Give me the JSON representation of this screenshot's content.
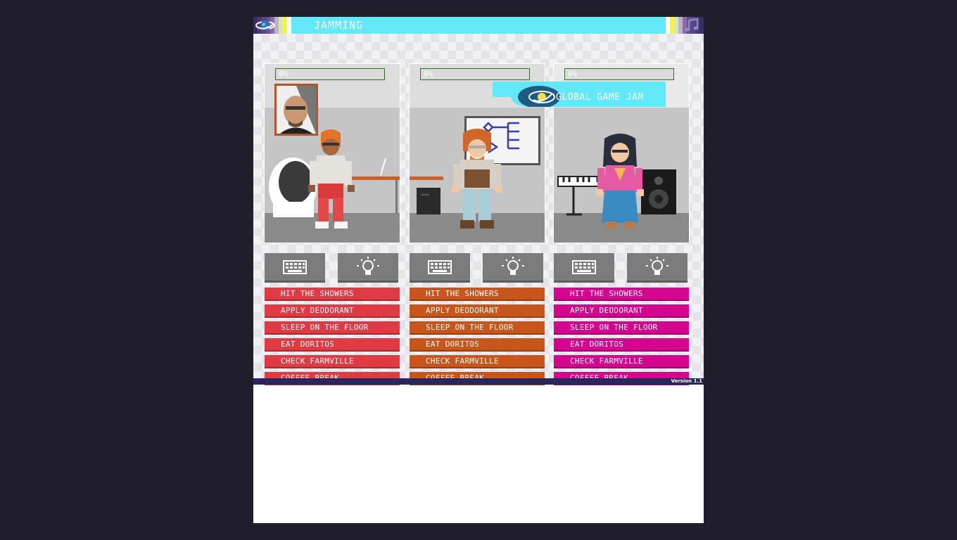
{
  "header": {
    "title": "JAMMING",
    "logo_icon": "globe-planet-icon",
    "music_icon": "music-note-icon",
    "accent": "#62e8f6",
    "stripe_colors": [
      "#3a2f62",
      "#4b3a7a",
      "#6a4b8f",
      "#8a6ba8",
      "#b9b2c8",
      "#e9f1a5",
      "#f4f04c"
    ]
  },
  "footer": {
    "version": "Version 1.1"
  },
  "banner": {
    "text": "GLOBAL GAME JAM",
    "icon": "globe-planet-icon"
  },
  "characters": [
    {
      "progress_label": "0%",
      "progress": 0,
      "accent": "#e03a44",
      "portrait_icon": "bald-man-portrait",
      "actions": [
        "HIT THE SHOWERS",
        "APPLY DEODORANT",
        "SLEEP ON THE FLOOR",
        "EAT DORITOS",
        "CHECK FARMVILLE",
        "COFFEE BREAK"
      ]
    },
    {
      "progress_label": "0%",
      "progress": 0,
      "accent": "#c8561c",
      "actions": [
        "HIT THE SHOWERS",
        "APPLY DEODORANT",
        "SLEEP ON THE FLOOR",
        "EAT DORITOS",
        "CHECK FARMVILLE",
        "COFFEE BREAK"
      ]
    },
    {
      "progress_label": "0%",
      "progress": 0,
      "accent": "#d4058e",
      "actions": [
        "HIT THE SHOWERS",
        "APPLY DEODORANT",
        "SLEEP ON THE FLOOR",
        "EAT DORITOS",
        "CHECK FARMVILLE",
        "COFFEE BREAK"
      ]
    }
  ],
  "tool_buttons": [
    "keyboard-icon",
    "lightbulb-icon"
  ]
}
